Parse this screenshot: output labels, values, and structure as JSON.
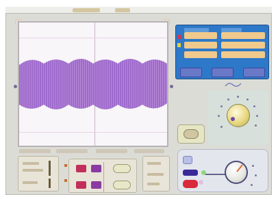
{
  "scope": {
    "title": "",
    "waveform": {
      "color": "#9b6dc6",
      "fill_color": "#a86ed0"
    }
  },
  "readout_panel": {
    "background": "#2d78c8",
    "cell_color": "#f0c98c",
    "button_color": "#6a78c8"
  },
  "colors": {
    "frame": "#dcdcd6",
    "screen_bg": "#f8f6f8",
    "red_button": "#c0305a",
    "purple_button": "#8a3aa0",
    "knob_bg": "#d8e0dc"
  },
  "icons": {
    "main_knob": "rotary-knob-icon",
    "lower_knob": "rotary-knob-icon",
    "toggle": "toggle-icon"
  }
}
